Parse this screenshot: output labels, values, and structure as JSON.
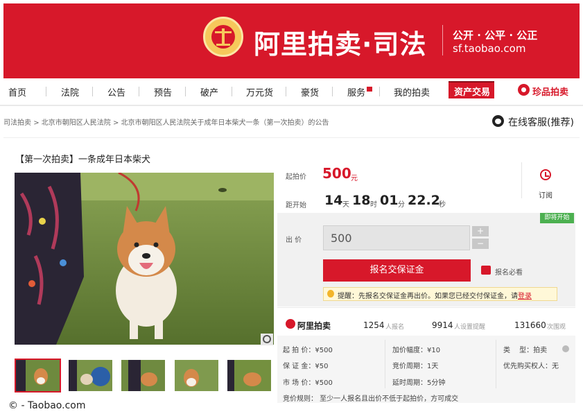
{
  "header": {
    "brand": "阿里拍卖·司法",
    "motto": "公开 · 公平 · 公正",
    "domain": "sf.taobao.com"
  },
  "nav": {
    "items": [
      "首页",
      "法院",
      "公告",
      "预告",
      "破产",
      "万元货",
      "豪货",
      "服务",
      "我的拍卖",
      "资产交易"
    ],
    "special": "珍品拍卖"
  },
  "breadcrumb": {
    "items": [
      "司法拍卖",
      "北京市朝阳区人民法院",
      "北京市朝阳区人民法院关于成年日本柴犬一条（第一次拍卖）的公告"
    ],
    "separator": ">"
  },
  "service": {
    "label": "在线客服(推荐)"
  },
  "item": {
    "title": "【第一次拍卖】一条成年日本柴犬"
  },
  "auction": {
    "start_price_label": "起拍价",
    "start_price": "500",
    "currency_unit": "元",
    "countdown_label": "距开始",
    "countdown": {
      "days": "14",
      "days_unit": "天",
      "hours": "18",
      "hours_unit": "时",
      "minutes": "01",
      "minutes_unit": "分",
      "seconds": "22.2",
      "seconds_unit": "秒"
    },
    "subscribe_label": "订阅",
    "status": "即将开始",
    "bid_label": "出 价",
    "bid_value": "500",
    "plus": "+",
    "minus": "−",
    "register_button": "报名交保证金",
    "must_read": "报名必看",
    "tip_prefix": "提醒：先报名交保证金再出价。如果您已经交付保证金，请",
    "tip_link": "登录"
  },
  "stats": {
    "brand": "阿里拍卖",
    "signups": "1254",
    "signups_label": "人报名",
    "reminders": "9914",
    "reminders_label": "人设置提醒",
    "views": "131660",
    "views_label": "次围观"
  },
  "details": {
    "start_price": "起 拍 价：¥500",
    "deposit": "保 证 金：¥50",
    "market_price": "市 场 价：¥500",
    "increment": "加价幅度：¥10",
    "bid_cycle": "竞价周期：1天",
    "delay_cycle": "延时周期：5分钟",
    "type": "类　 型：拍卖",
    "priority": "优先购买权人",
    "priority_value": "：无",
    "rules": "竞价规则：  至少一人报名且出价不低于起拍价，方可成交"
  },
  "caption": "© - Taobao.com",
  "colors": {
    "brand_red": "#d7182a",
    "status_green": "#4cb050"
  }
}
